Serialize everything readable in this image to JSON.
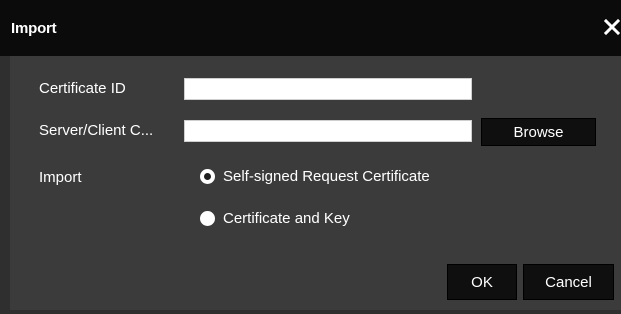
{
  "dialog": {
    "title": "Import",
    "close_icon": "close-icon"
  },
  "form": {
    "certificate_id_label": "Certificate ID",
    "certificate_id_value": "",
    "server_client_label": "Server/Client C...",
    "server_client_value": "",
    "browse_label": "Browse",
    "import_label": "Import",
    "options": [
      {
        "label": "Self-signed Request Certificate",
        "selected": true
      },
      {
        "label": "Certificate and Key",
        "selected": false
      }
    ]
  },
  "footer": {
    "ok_label": "OK",
    "cancel_label": "Cancel"
  },
  "colors": {
    "titlebar": "#0b0b0b",
    "body": "#3b3b3b",
    "button": "#0f0f0f",
    "text": "#ffffff"
  }
}
